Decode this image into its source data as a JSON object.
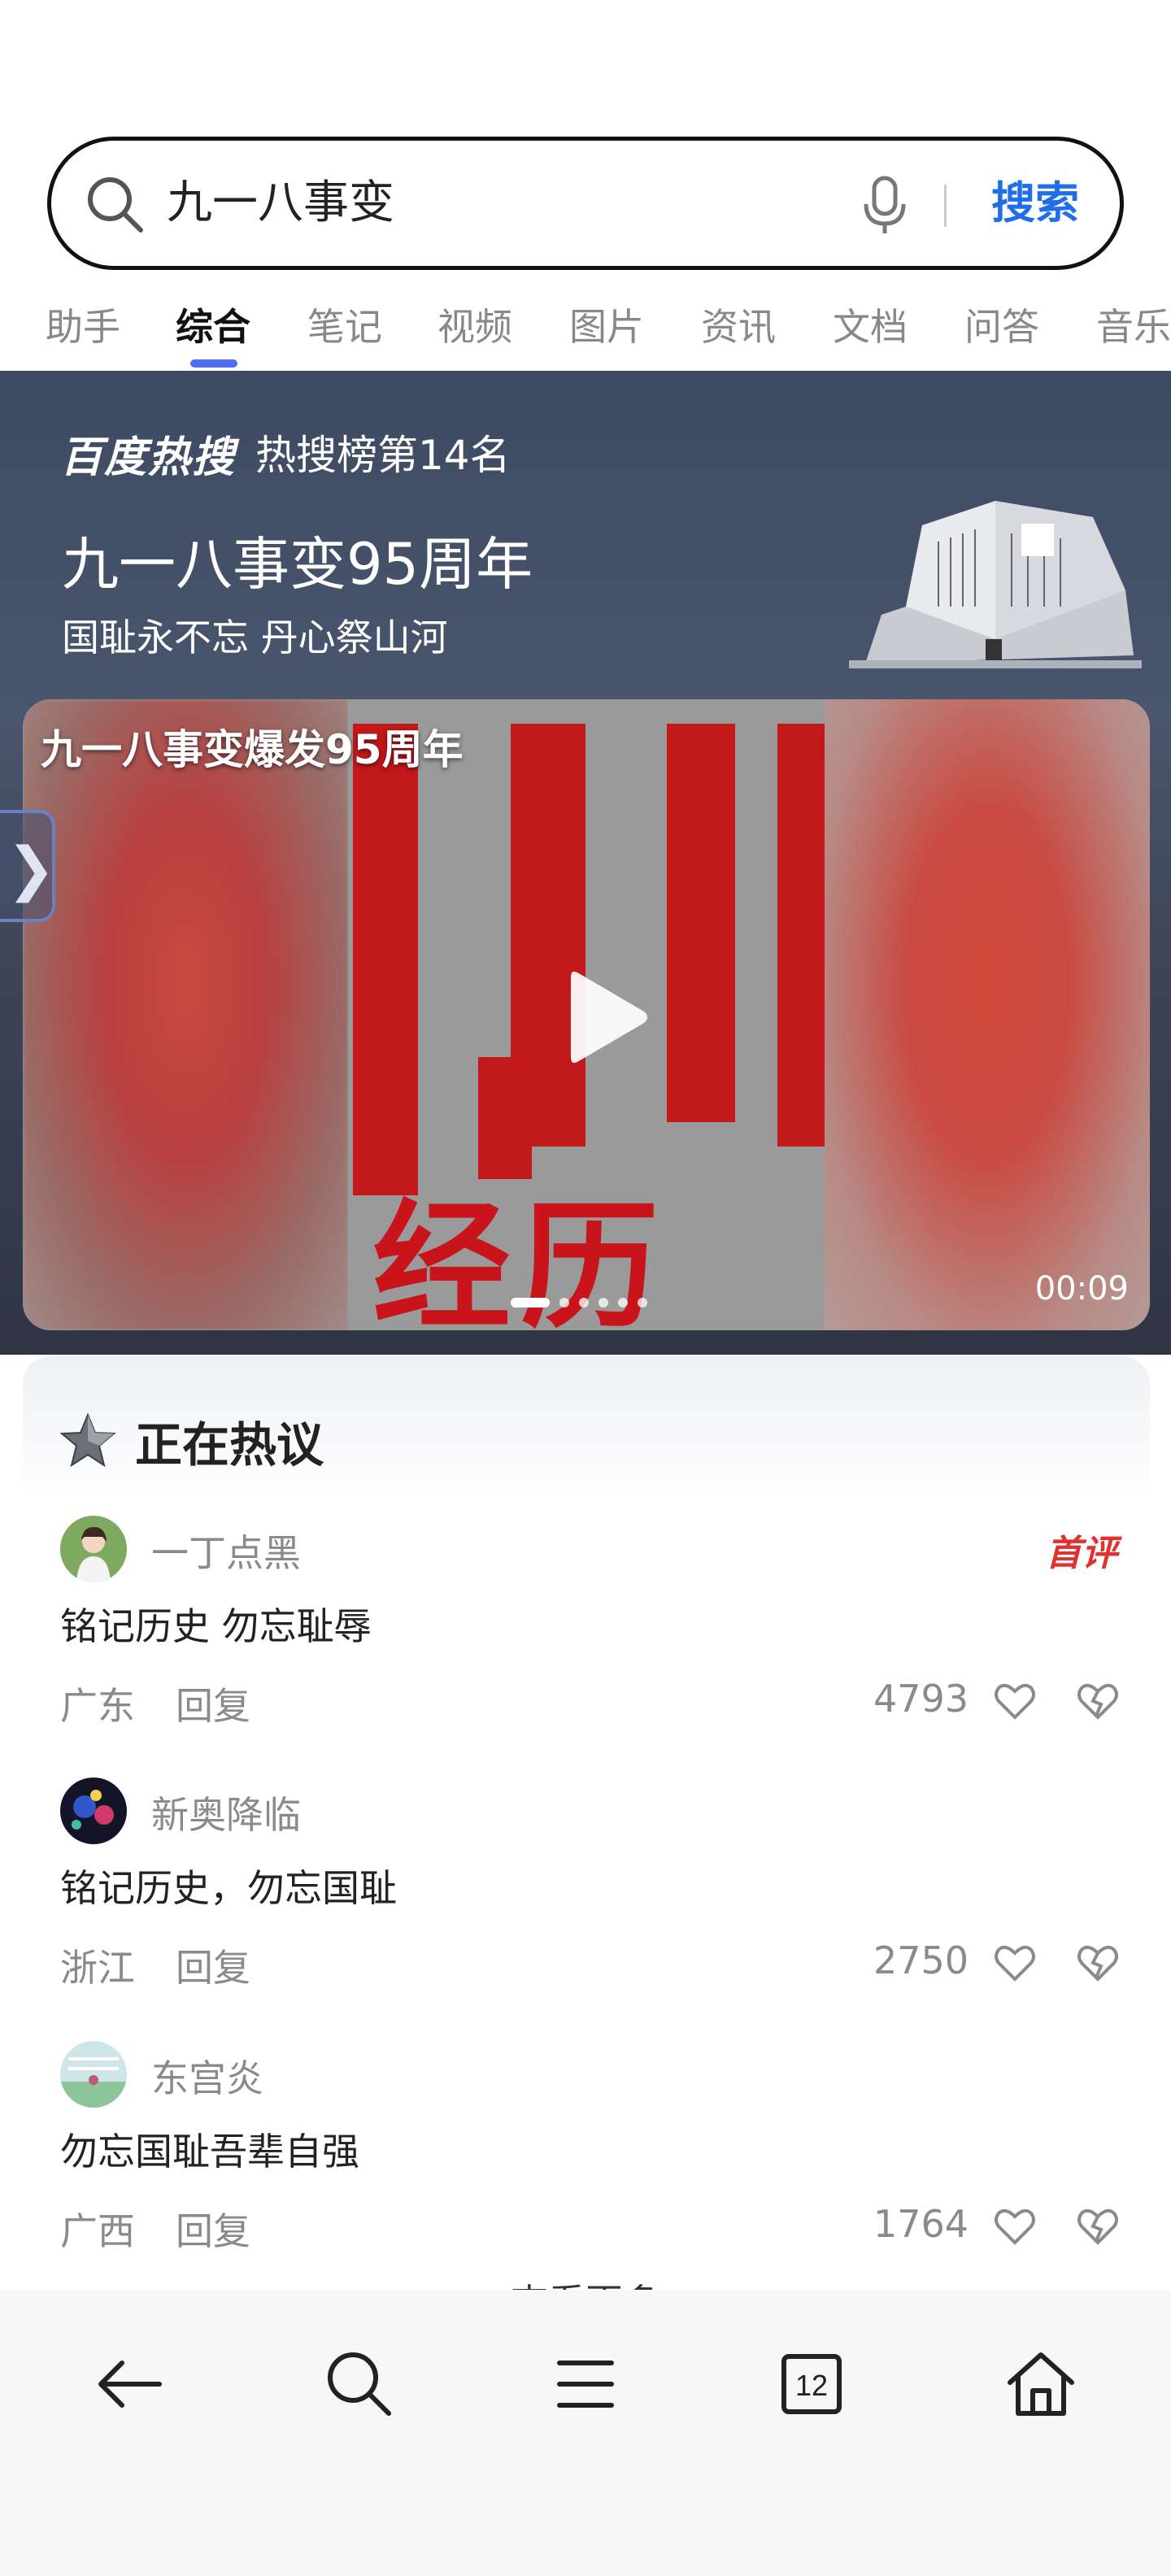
{
  "search": {
    "query": "九一八事变",
    "button_label": "搜索"
  },
  "tabs": [
    {
      "label": "助手"
    },
    {
      "label": "综合"
    },
    {
      "label": "笔记"
    },
    {
      "label": "视频"
    },
    {
      "label": "图片"
    },
    {
      "label": "资讯"
    },
    {
      "label": "文档"
    },
    {
      "label": "问答"
    },
    {
      "label": "音乐"
    }
  ],
  "active_tab": "综合",
  "hot": {
    "brand": "百度热搜",
    "rank": "热搜榜第14名",
    "title": "九一八事变95周年",
    "subtitle": "国耻永不忘 丹心祭山河"
  },
  "video": {
    "title": "九一八事变爆发95周年",
    "duration": "00:09",
    "slide_count": 6,
    "active_slide": 1,
    "overlay_text": "经历"
  },
  "discussion": {
    "title": "正在热议",
    "see_more": "查看更多",
    "comments": [
      {
        "user": "一丁点黑",
        "tag": "首评",
        "text": "铭记历史 勿忘耻辱",
        "location": "广东",
        "reply": "回复",
        "likes": "4793"
      },
      {
        "user": "新奥降临",
        "tag": "",
        "text": "铭记历史，勿忘国耻",
        "location": "浙江",
        "reply": "回复",
        "likes": "2750"
      },
      {
        "user": "东宫炎",
        "tag": "",
        "text": "勿忘国耻吾辈自强",
        "location": "广西",
        "reply": "回复",
        "likes": "1764"
      }
    ]
  },
  "bottom_nav": {
    "tab_count": "12"
  },
  "colors": {
    "accent": "#1f6fe8",
    "tab_indicator": "#4e6ef2",
    "first_comment_tag": "#e0322f"
  }
}
